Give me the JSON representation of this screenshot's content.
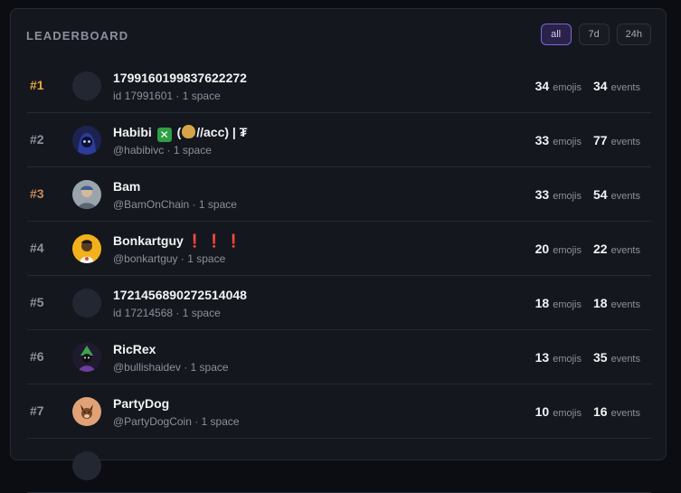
{
  "leaderboard": {
    "title": "LEADERBOARD",
    "filters": [
      {
        "label": "all",
        "active": true
      },
      {
        "label": "7d",
        "active": false
      },
      {
        "label": "24h",
        "active": false
      }
    ],
    "emojis_unit": "emojis",
    "events_unit": "events",
    "rows": [
      {
        "rank": "#1",
        "name": "1799160199837622272",
        "sub": "id 17991601 · 1 space",
        "emojis": "34",
        "events": "34",
        "avatar": "empty-avatar"
      },
      {
        "rank": "#2",
        "name_a": "Habibi",
        "name_b": "(",
        "name_c": "//acc) | ₮",
        "sub": "@habibivc · 1 space",
        "emojis": "33",
        "events": "77",
        "avatar": "hooded-figure-avatar"
      },
      {
        "rank": "#3",
        "name": "Bam",
        "sub": "@BamOnChain · 1 space",
        "emojis": "33",
        "events": "54",
        "avatar": "person-avatar"
      },
      {
        "rank": "#4",
        "name": "Bonkartguy",
        "name_suffix": "❗ ❗ ❗",
        "sub": "@bonkartguy · 1 space",
        "emojis": "20",
        "events": "22",
        "avatar": "cartoon-avatar"
      },
      {
        "rank": "#5",
        "name": "1721456890272514048",
        "sub": "id 17214568 · 1 space",
        "emojis": "18",
        "events": "18",
        "avatar": "empty-avatar"
      },
      {
        "rank": "#6",
        "name": "RicRex",
        "sub": "@bullishaidev · 1 space",
        "emojis": "13",
        "events": "35",
        "avatar": "wizard-avatar"
      },
      {
        "rank": "#7",
        "name": "PartyDog",
        "sub": "@PartyDogCoin · 1 space",
        "emojis": "10",
        "events": "16",
        "avatar": "dog-avatar"
      }
    ]
  },
  "colors": {
    "gold": "#e3a63b",
    "bronze": "#c98b57",
    "accent": "#7a66d8"
  }
}
